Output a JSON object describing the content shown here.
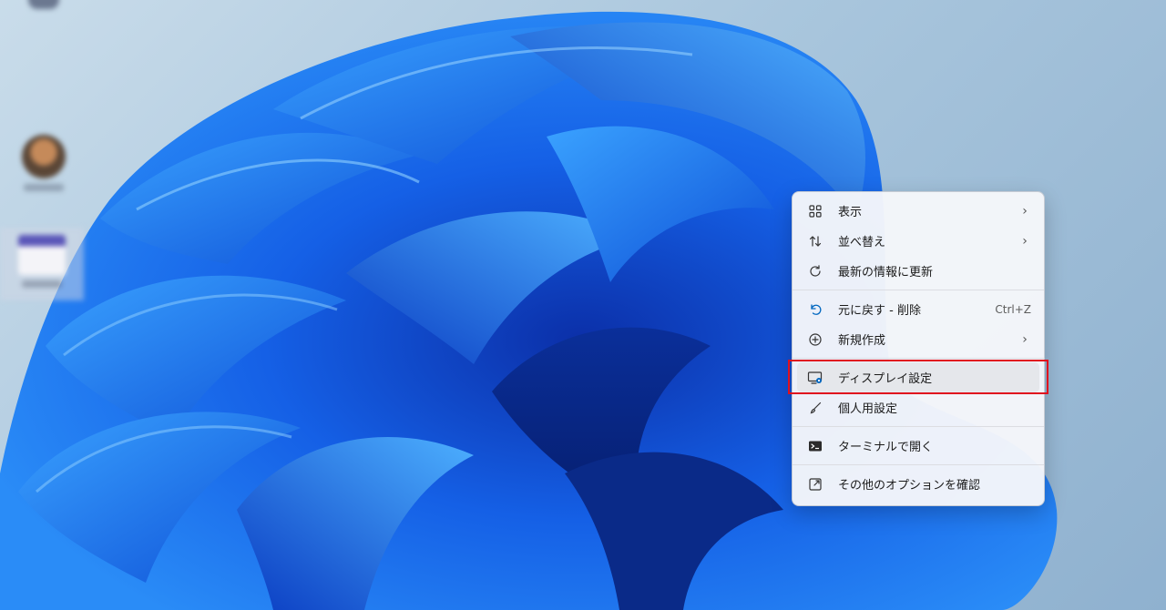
{
  "desktop": {
    "icons": [
      {
        "name": "desktop-icon-top"
      },
      {
        "name": "desktop-icon-user"
      },
      {
        "name": "desktop-icon-app"
      }
    ]
  },
  "context_menu": {
    "items": [
      {
        "label": "表示",
        "icon": "grid-icon",
        "has_submenu": true
      },
      {
        "label": "並べ替え",
        "icon": "sort-arrows-icon",
        "has_submenu": true
      },
      {
        "label": "最新の情報に更新",
        "icon": "refresh-icon",
        "has_submenu": false
      },
      {
        "label": "元に戻す - 削除",
        "icon": "undo-icon",
        "shortcut": "Ctrl+Z"
      },
      {
        "label": "新規作成",
        "icon": "plus-circle-icon",
        "has_submenu": true
      },
      {
        "label": "ディスプレイ設定",
        "icon": "display-settings-icon",
        "highlighted": true
      },
      {
        "label": "個人用設定",
        "icon": "brush-icon"
      },
      {
        "label": "ターミナルで開く",
        "icon": "terminal-icon"
      },
      {
        "label": "その他のオプションを確認",
        "icon": "open-external-icon"
      }
    ],
    "submenu_arrow": "›"
  },
  "colors": {
    "accent": "#0067c0",
    "highlight_outline": "#e0101e"
  }
}
